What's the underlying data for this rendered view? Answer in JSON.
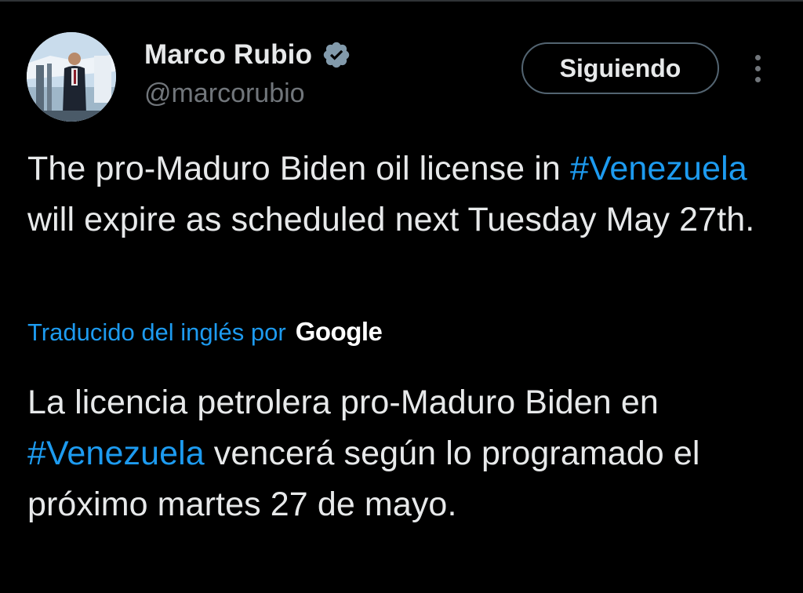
{
  "tweet": {
    "author": {
      "name": "Marco Rubio",
      "handle": "@marcorubio",
      "verified_color": "#829aab"
    },
    "follow_button_label": "Siguiendo",
    "original": {
      "before_hashtag": "The pro-Maduro Biden oil  license in ",
      "hashtag": "#Venezuela",
      "after_hashtag": " will expire as scheduled next Tuesday May 27th."
    },
    "translation_label": "Traducido del inglés por",
    "translation_provider": "Google",
    "translated": {
      "before_hashtag": "La licencia petrolera pro-Maduro Biden en ",
      "hashtag": "#Venezuela",
      "after_hashtag": " vencerá según lo programado el próximo martes 27 de mayo."
    }
  },
  "colors": {
    "background": "#000000",
    "link": "#1d9bf0",
    "text": "#e7e9ea",
    "secondary": "#71767b"
  }
}
